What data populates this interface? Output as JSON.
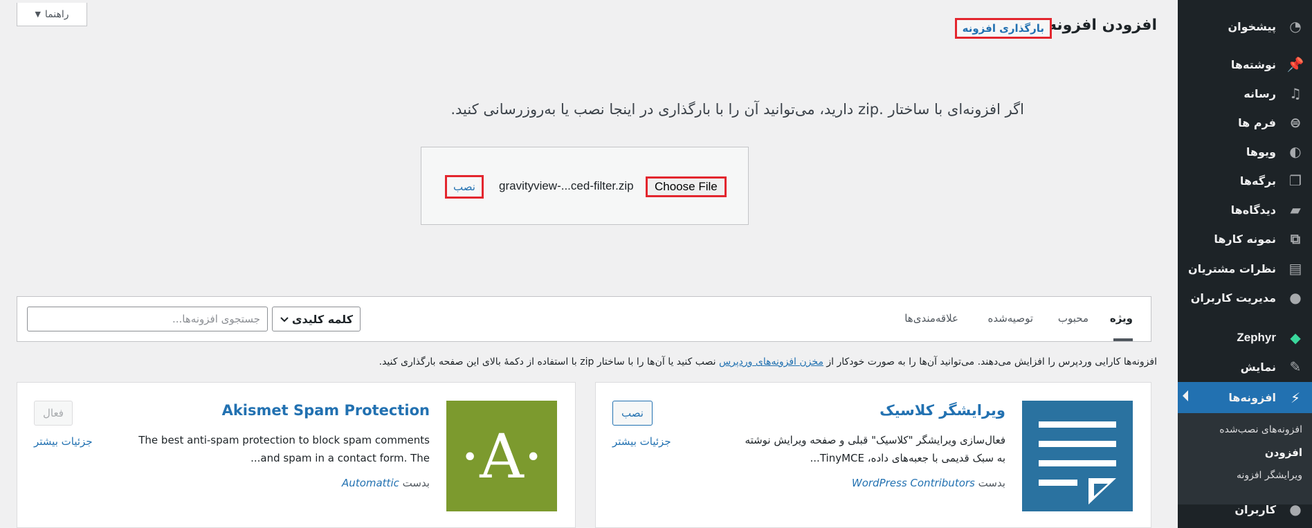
{
  "help_tab": {
    "label": "راهنما"
  },
  "page": {
    "title": "افزودن افزونه",
    "upload_button": "بارگذاری افزونه",
    "upload_help": "اگر افزونه‌ای با ساختار .zip دارید، می‌توانید آن را با بارگذاری در اینجا نصب یا به‌روزرسانی کنید.",
    "choose_file_label": "Choose File",
    "chosen_file": "gravityview-...ced-filter.zip",
    "install_now": "نصب"
  },
  "filter": {
    "tabs": [
      {
        "label": "ویژه",
        "current": true
      },
      {
        "label": "محبوب"
      },
      {
        "label": "توصیه‌شده"
      },
      {
        "label": "علاقه‌مندی‌ها"
      }
    ],
    "search_type": "کلمه کلیدی",
    "search_placeholder": "جستجوی افزونه‌ها..."
  },
  "intro": {
    "before": "افزونه‌ها کارایی وردپرس را افزایش می‌دهند. می‌توانید آن‌ها را به صورت خودکار از",
    "link": "مخزن افزونه‌های وردپرس",
    "after": "نصب کنید یا آن‌ها را با ساختار zip با استفاده از دکمهٔ بالای این صفحه بارگذاری کنید."
  },
  "cards": [
    {
      "name": "ویرایشگر کلاسیک",
      "desc1": "فعال‌سازی ویرایشگر \"کلاسیک\" قبلی و صفحه ویرایش نوشته",
      "desc2": "به سبک قدیمی با جعبه‌های داده، TinyMCE...",
      "author_prefix": "بدست",
      "author": "WordPress Contributors",
      "action": "نصب",
      "more": "جزئیات بیشتر"
    },
    {
      "name": "Akismet Spam Protection",
      "desc1": "The best anti-spam protection to block spam comments",
      "desc2": "and spam in a contact form. The...",
      "author_prefix": "بدست",
      "author": "Automattic",
      "action": "فعال",
      "more": "جزئیات بیشتر",
      "thumb_letter": "·A·"
    }
  ],
  "sidebar": {
    "items": [
      {
        "label": "پیشخوان",
        "icon": "dashboard-icon"
      },
      {
        "label": "نوشته‌ها",
        "icon": "pin-icon"
      },
      {
        "label": "رسانه",
        "icon": "media-icon"
      },
      {
        "label": "فرم ها",
        "icon": "forms-icon"
      },
      {
        "label": "ویوها",
        "icon": "views-icon"
      },
      {
        "label": "برگه‌ها",
        "icon": "pages-icon"
      },
      {
        "label": "دیدگاه‌ها",
        "icon": "comments-icon"
      },
      {
        "label": "نمونه کارها",
        "icon": "portfolio-icon"
      },
      {
        "label": "نظرات مشتریان",
        "icon": "testimonials-icon"
      },
      {
        "label": "مدیریت کاربران",
        "icon": "user-management-icon"
      },
      {
        "label": "Zephyr",
        "icon": "diamond-icon"
      },
      {
        "label": "نمایش",
        "icon": "brush-icon"
      },
      {
        "label": "افزونه‌ها",
        "icon": "plugins-icon",
        "active": true
      },
      {
        "label": "کاربران",
        "icon": "users-icon"
      }
    ],
    "submenu": [
      "افزونه‌های نصب‌شده",
      "افزودن",
      "ویرایشگر افزونه"
    ]
  },
  "colors": {
    "accent": "#2271b1",
    "highlight_border": "#e3262e",
    "sidebar_bg": "#1d2327",
    "zephyr": "#3ad89d",
    "akismet_green": "#7c9a2e",
    "classic_blue": "#2a72a0"
  }
}
